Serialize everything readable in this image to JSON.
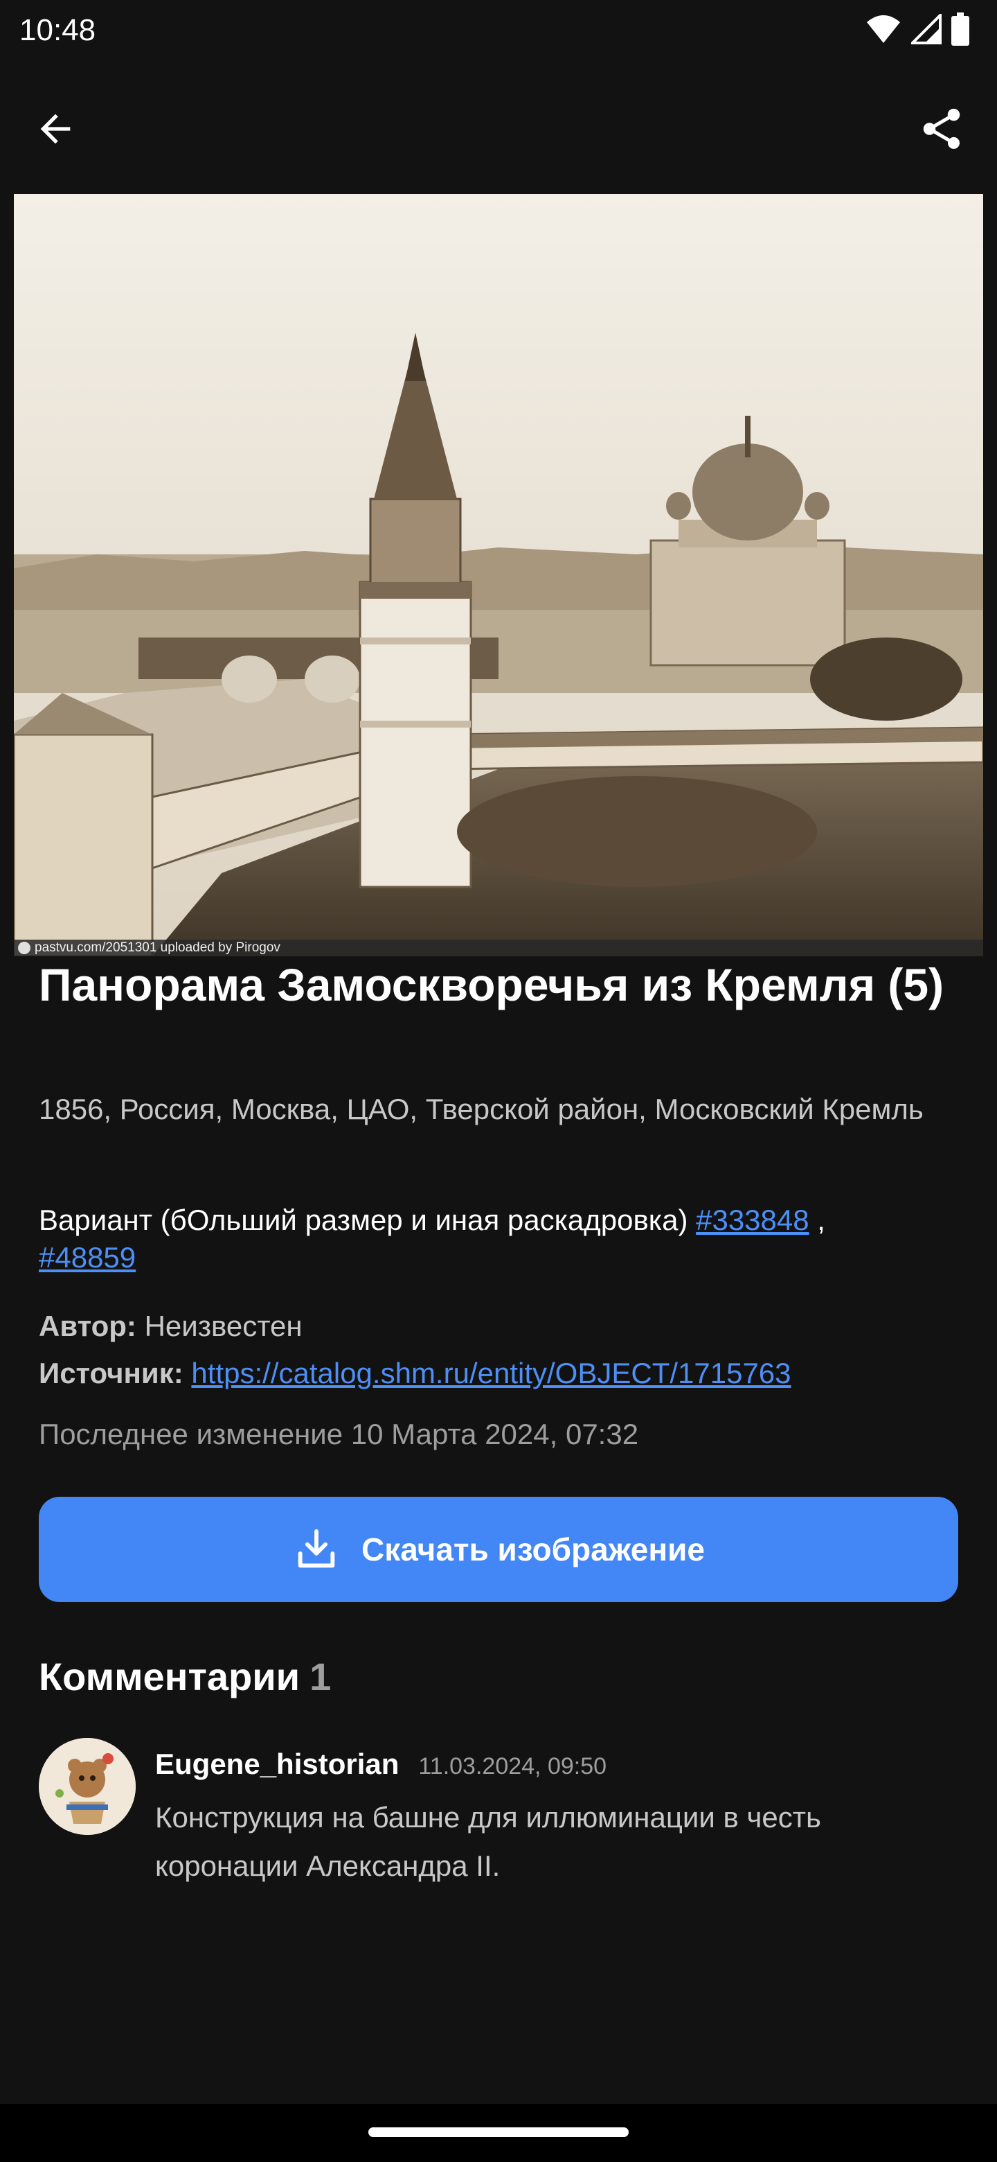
{
  "status_bar": {
    "time": "10:48"
  },
  "photo": {
    "caption": "pastvu.com/2051301  uploaded by Pirogov"
  },
  "title": "Панорама Замоскворечья из Кремля (5)",
  "meta": "1856, Россия, Москва, ЦАО, Тверской район, Московский Кремль",
  "variant": {
    "text": "Вариант (бОльший размер и иная раскадровка) ",
    "link1": "#333848",
    "separator": " ,",
    "link2": "#48859"
  },
  "author": {
    "label": "Автор:",
    "value": " Неизвестен"
  },
  "source": {
    "label": "Источник:",
    "value": "https://catalog.shm.ru/entity/OBJECT/1715763"
  },
  "modified": "Последнее изменение 10 Марта 2024, 07:32",
  "download_button": {
    "label": "Скачать изображение"
  },
  "comments": {
    "heading": "Комментарии",
    "count": "1",
    "items": [
      {
        "author": "Eugene_historian",
        "date": "11.03.2024, 09:50",
        "text": "Конструкция на башне для иллюминации в честь коронации Александра II."
      }
    ]
  },
  "icons": {
    "back": "arrow-left-icon",
    "share": "share-icon",
    "download": "download-icon",
    "wifi": "wifi-icon",
    "signal": "signal-icon",
    "battery": "battery-icon"
  },
  "colors": {
    "background": "#121212",
    "accent": "#4287f5",
    "link": "#4d8ff5"
  }
}
